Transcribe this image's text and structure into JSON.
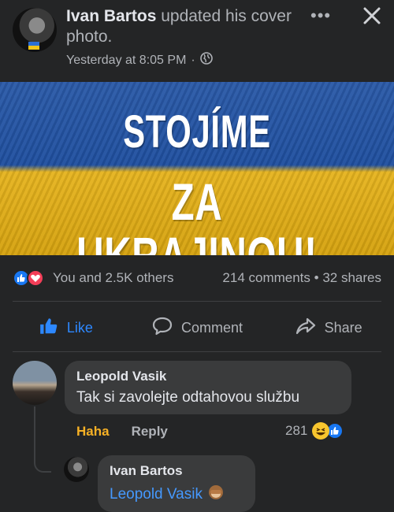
{
  "post": {
    "author": "Ivan Bartos",
    "action_text": " updated his cover photo.",
    "timestamp": "Yesterday at 8:05 PM",
    "separator": "·",
    "more_icon": "more-dots-icon",
    "close_icon": "close-icon",
    "privacy_icon": "globe-icon"
  },
  "cover": {
    "line1": "STOJÍME",
    "line2": "ZA UKRAJINOU!",
    "flag_colors": {
      "blue": "#2b5aa8",
      "yellow": "#e6b41f"
    }
  },
  "reactions": {
    "summary": "You and 2.5K others",
    "comments": "214 comments",
    "dot": "•",
    "shares": "32 shares",
    "icons": [
      "like-reaction-icon",
      "love-reaction-icon"
    ]
  },
  "actions": {
    "like": "Like",
    "comment": "Comment",
    "share": "Share"
  },
  "comment": {
    "author": "Leopold Vasik",
    "text": "Tak si zavolejte odtahovou službu",
    "haha_label": "Haha",
    "reply_label": "Reply",
    "reaction_count": "281",
    "reaction_icons": [
      "haha-reaction-icon",
      "like-reaction-icon"
    ]
  },
  "reply": {
    "author": "Ivan Bartos",
    "mention": "Leopold Vasik",
    "emoji": "see-no-evil-monkey-icon"
  },
  "colors": {
    "background": "#242526",
    "bubble": "#3a3b3c",
    "accent_blue": "#2d88ff",
    "haha_yellow": "#f7b125"
  }
}
